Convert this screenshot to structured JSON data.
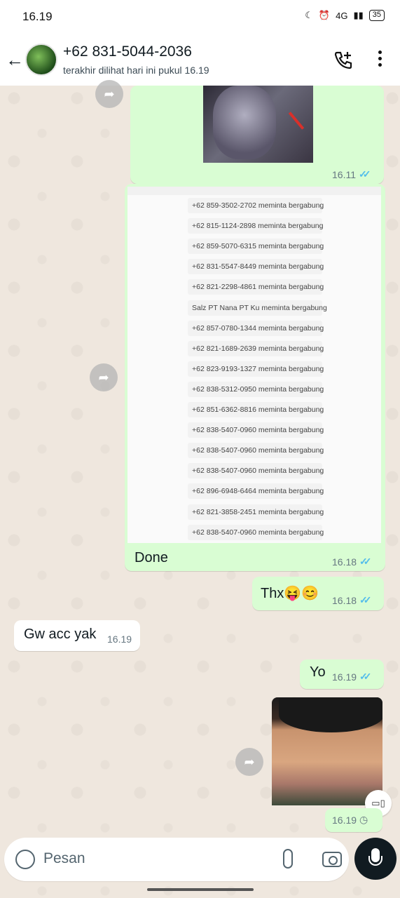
{
  "status": {
    "time": "16.19",
    "battery": "35",
    "net": "4G"
  },
  "header": {
    "contact": "+62 831-5044-2036",
    "last_seen": "terakhir dilihat hari ini pukul 16.19"
  },
  "messages": {
    "m1": {
      "time": "16.11"
    },
    "m2": {
      "caption": "Done",
      "time": "16.18",
      "requests": [
        "+62 859-3502-2702 meminta bergabung",
        "+62 815-1124-2898 meminta bergabung",
        "+62 859-5070-6315 meminta bergabung",
        "+62 831-5547-8449 meminta bergabung",
        "+62 821-2298-4861 meminta bergabung",
        "Salz PT Nana PT Ku meminta bergabung",
        "+62 857-0780-1344 meminta bergabung",
        "+62 821-1689-2639 meminta bergabung",
        "+62 823-9193-1327 meminta bergabung",
        "+62 838-5312-0950 meminta bergabung",
        "+62 851-6362-8816 meminta bergabung",
        "+62 838-5407-0960 meminta bergabung",
        "+62 838-5407-0960 meminta bergabung",
        "+62 838-5407-0960 meminta bergabung",
        "+62 896-6948-6464 meminta bergabung",
        "+62 821-3858-2451 meminta bergabung",
        "+62 838-5407-0960 meminta bergabung"
      ]
    },
    "m3": {
      "text": "Thx😝😊",
      "time": "16.18"
    },
    "m4": {
      "text": "Gw acc yak",
      "time": "16.19"
    },
    "m5": {
      "text": "Yo",
      "time": "16.19"
    },
    "m6": {
      "time": "16.19"
    }
  },
  "input": {
    "placeholder": "Pesan"
  },
  "colors": {
    "outgoing": "#d9fdd3",
    "incoming": "#ffffff",
    "ticks": "#53bdeb"
  }
}
